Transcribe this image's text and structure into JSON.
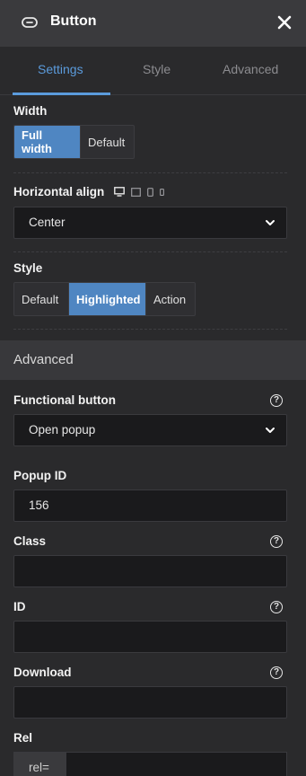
{
  "header": {
    "title": "Button",
    "icon": "button-icon",
    "close_icon": "close-icon"
  },
  "tabs": [
    {
      "label": "Settings",
      "active": true
    },
    {
      "label": "Style",
      "active": false
    },
    {
      "label": "Advanced",
      "active": false
    }
  ],
  "width": {
    "label": "Width",
    "options": [
      "Full width",
      "Default"
    ],
    "selected": "Full width"
  },
  "horizontal_align": {
    "label": "Horizontal align",
    "devices": [
      "desktop-icon",
      "laptop-icon",
      "tablet-icon",
      "mobile-icon"
    ],
    "value": "Center"
  },
  "style": {
    "label": "Style",
    "options": [
      "Default",
      "Highlighted",
      "Action"
    ],
    "selected": "Highlighted"
  },
  "advanced_section": {
    "title": "Advanced"
  },
  "functional_button": {
    "label": "Functional button",
    "value": "Open popup"
  },
  "popup_id": {
    "label": "Popup ID",
    "value": "156"
  },
  "class_field": {
    "label": "Class",
    "value": ""
  },
  "id_field": {
    "label": "ID",
    "value": ""
  },
  "download_field": {
    "label": "Download",
    "value": ""
  },
  "rel_field": {
    "label": "Rel",
    "prefix": "rel=",
    "value": ""
  },
  "colors": {
    "accent": "#5b9bdc",
    "selected_bg": "#4f86c2",
    "panel_bg": "#2a2a2c",
    "header_bg": "#3a3a3d",
    "input_bg": "#1a1a1c"
  }
}
